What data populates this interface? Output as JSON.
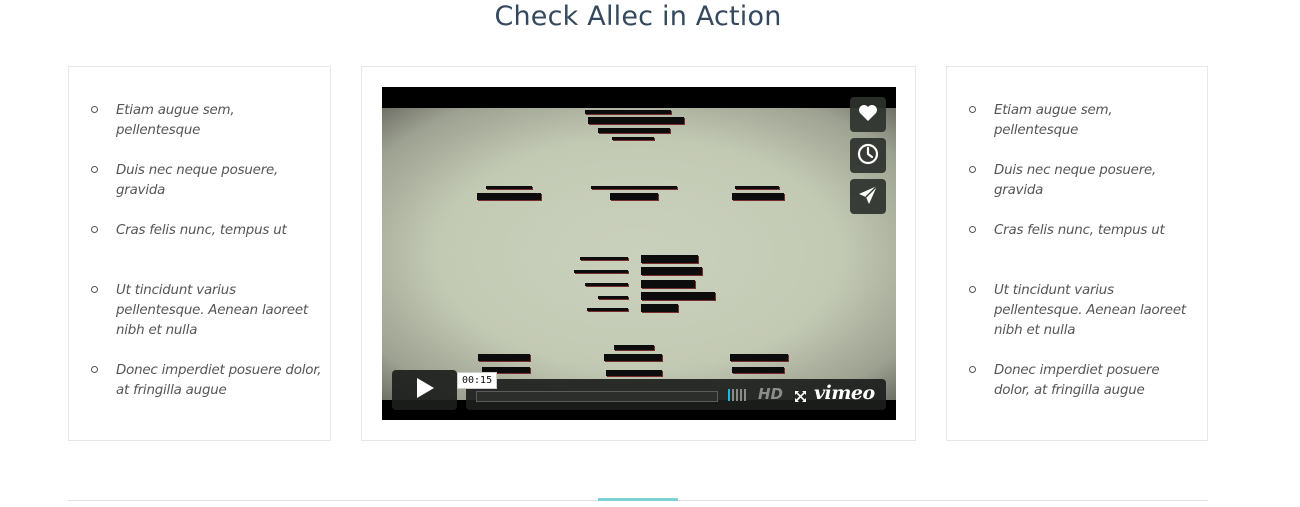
{
  "section": {
    "title": "Check Allec in Action"
  },
  "left_features": [
    "Etiam augue sem, pellentesque",
    "Duis nec neque posuere, gravida",
    "Cras felis nunc, tempus ut",
    "Ut tincidunt varius pellentesque. Aenean laoreet nibh et nulla",
    "Donec imperdiet posuere dolor, at fringilla augue"
  ],
  "right_features": [
    "Etiam augue sem, pellentesque",
    "Duis nec neque posuere, gravida",
    "Cras felis nunc, tempus ut",
    "Ut tincidunt varius pellentesque. Aenean laoreet nibh et nulla",
    "Donec imperdiet posuere dolor, at fringilla augue"
  ],
  "video": {
    "timecode": "00:15",
    "hd_label": "HD",
    "brand": "vimeo",
    "progress_fraction": 0,
    "icons": [
      "heart-icon",
      "clock-icon",
      "send-icon",
      "play-icon",
      "fullscreen-icon"
    ],
    "accent_color": "#1ab7ea"
  },
  "colors": {
    "title": "#34495e",
    "divider_accent": "#7fd1d8"
  }
}
